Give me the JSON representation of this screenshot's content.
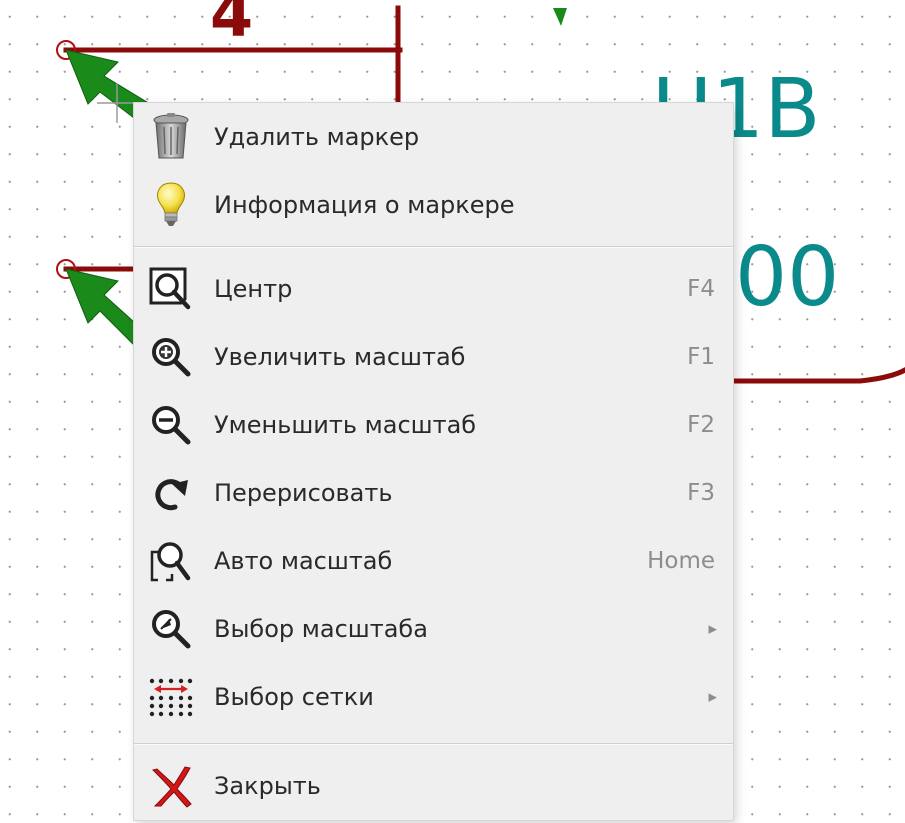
{
  "schematic": {
    "part_ref": "U1B",
    "part_value_fragment": "00",
    "pin_number_fragment": "4"
  },
  "context_menu": {
    "group1": [
      {
        "label": "Удалить маркер",
        "icon": "trash-can-icon"
      },
      {
        "label": "Информация о маркере",
        "icon": "light-bulb-icon"
      }
    ],
    "group2": [
      {
        "label": "Центр",
        "shortcut": "F4",
        "icon": "center-view-icon"
      },
      {
        "label": "Увеличить масштаб",
        "shortcut": "F1",
        "icon": "zoom-in-icon"
      },
      {
        "label": "Уменьшить масштаб",
        "shortcut": "F2",
        "icon": "zoom-out-icon"
      },
      {
        "label": "Перерисовать",
        "shortcut": "F3",
        "icon": "redraw-icon"
      },
      {
        "label": "Авто масштаб",
        "shortcut": "Home",
        "icon": "zoom-fit-icon"
      },
      {
        "label": "Выбор масштаба",
        "submenu": true,
        "icon": "zoom-select-icon"
      },
      {
        "label": "Выбор сетки",
        "submenu": true,
        "icon": "grid-select-icon"
      }
    ],
    "group3": [
      {
        "label": "Закрыть",
        "icon": "close-icon"
      }
    ]
  },
  "colors": {
    "wire": "#8b0a0a",
    "part_text": "#0a8a8a",
    "marker": "#1a8a1a",
    "menu_bg": "#efefef",
    "label_text": "#2a2a2a",
    "shortcut_text": "#8d8d8d"
  }
}
